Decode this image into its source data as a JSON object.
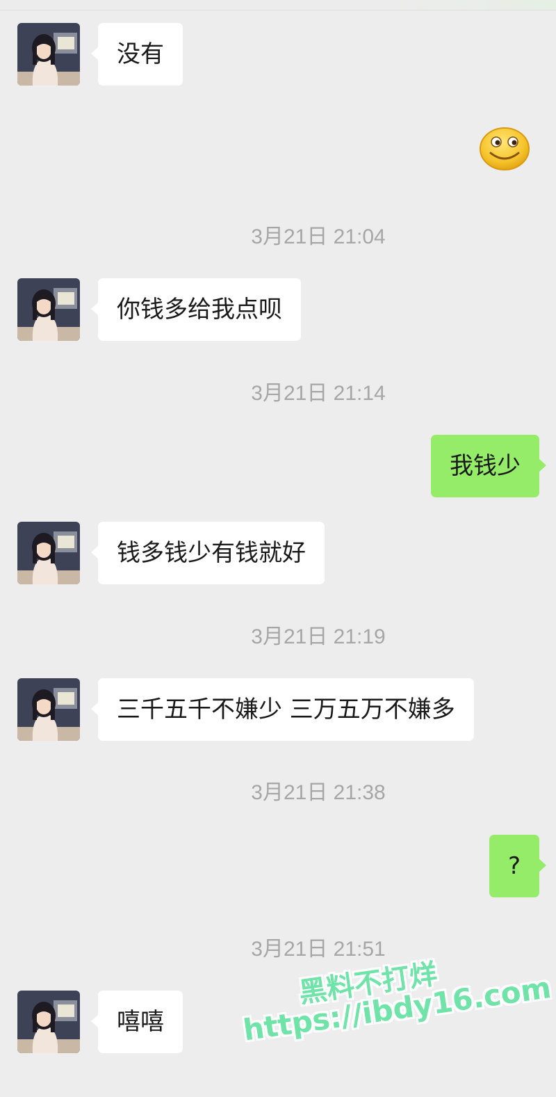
{
  "colors": {
    "background": "#ededed",
    "incoming_bubble": "#ffffff",
    "outgoing_bubble": "#95ec69",
    "timestamp_text": "#a6a6a6",
    "watermark": "#6fe3a8"
  },
  "messages": [
    {
      "sender": "contact",
      "text": "没有"
    },
    {
      "sender": "me",
      "type": "emoji",
      "icon": "smile-emoji-icon"
    },
    {
      "type": "timestamp",
      "text": "3月21日 21:04"
    },
    {
      "sender": "contact",
      "text": "你钱多给我点呗"
    },
    {
      "type": "timestamp",
      "text": "3月21日 21:14"
    },
    {
      "sender": "me",
      "text": "我钱少"
    },
    {
      "sender": "contact",
      "text": "钱多钱少有钱就好"
    },
    {
      "type": "timestamp",
      "text": "3月21日 21:19"
    },
    {
      "sender": "contact",
      "text": "三千五千不嫌少 三万五万不嫌多"
    },
    {
      "type": "timestamp",
      "text": "3月21日 21:38"
    },
    {
      "sender": "me",
      "text": "?"
    },
    {
      "type": "timestamp",
      "text": "3月21日 21:51"
    },
    {
      "sender": "contact",
      "text": "嘻嘻"
    }
  ],
  "watermark": {
    "title": "黑料不打烊",
    "url": "https://ibdy16.com"
  }
}
